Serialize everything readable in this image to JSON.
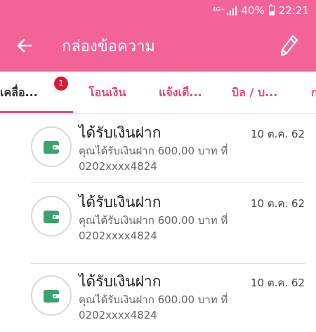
{
  "status_bar": {
    "network": "4G+",
    "battery_percent": "40%",
    "battery_level": 0.4,
    "time": "22:21"
  },
  "app_bar": {
    "title": "กล่องข้อความ",
    "back_icon": "arrow-left-icon",
    "edit_icon": "pencil-icon"
  },
  "tabs": [
    {
      "label": "เคลื่อ...",
      "active": true,
      "badge": "1"
    },
    {
      "label": "โอนเงิน",
      "active": false
    },
    {
      "label": "แจ้งเตื...",
      "active": false
    },
    {
      "label": "บิล / บ...",
      "active": false
    },
    {
      "label": "ก",
      "active": false
    }
  ],
  "messages": [
    {
      "icon": "wallet-icon",
      "title": "ได้รับเงินฝาก",
      "date": "10 ต.ค. 62",
      "body_line1": "คุณได้รับเงินฝาก 600.00 บาท ที่",
      "body_line2": "0202xxxx4824"
    },
    {
      "icon": "wallet-icon",
      "title": "ได้รับเงินฝาก",
      "date": "10 ต.ค. 62",
      "body_line1": "คุณได้รับเงินฝาก 600.00 บาท ที่",
      "body_line2": "0202xxxx4824"
    },
    {
      "icon": "wallet-icon",
      "title": "ได้รับเงินฝาก",
      "date": "10 ต.ค. 62",
      "body_line1": "คุณได้รับเงินฝาก 600.00 บาท ที่",
      "body_line2": "0202xxxx4824"
    }
  ],
  "colors": {
    "primary_pink": "#f26496",
    "tab_text": "#e8447c",
    "badge_red": "#d81b3a",
    "wallet_green": "#3aa36b"
  }
}
